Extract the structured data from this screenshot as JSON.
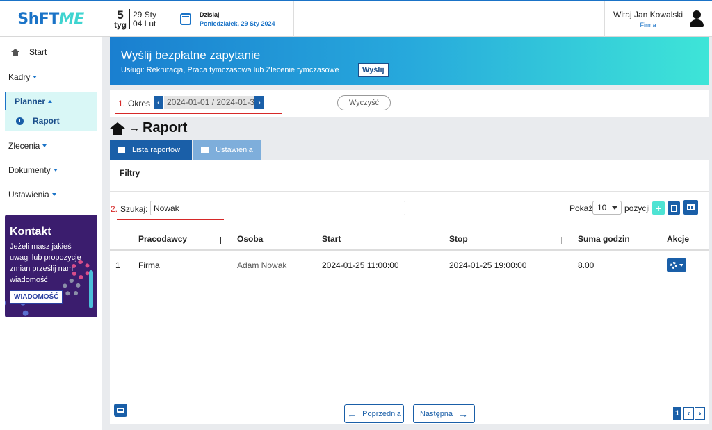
{
  "header": {
    "logo_part1": "ShFT",
    "logo_part2": "ME",
    "week_number": "5",
    "week_label": "tyg",
    "week_start": "29 Sty",
    "week_end": "04 Lut",
    "today_label": "Dzisiaj",
    "today_date": "Poniedziałek, 29 Sty 2024",
    "greeting": "Witaj Jan Kowalski",
    "company": "Firma"
  },
  "sidebar": {
    "items": [
      {
        "label": "Start"
      },
      {
        "label": "Kadry"
      },
      {
        "label": "Planner"
      },
      {
        "label": "Raport"
      },
      {
        "label": "Zlecenia"
      },
      {
        "label": "Dokumenty"
      },
      {
        "label": "Ustawienia"
      }
    ],
    "contact": {
      "title": "Kontakt",
      "text": "Jeżeli masz jakieś uwagi lub propozycje zmian prześlij nam wiadomość",
      "button": "WIADOMOŚĆ"
    }
  },
  "banner": {
    "title": "Wyślij bezpłatne zapytanie",
    "subtitle": "Usługi: Rekrutacja, Praca tymczasowa lub Zlecenie tymczasowe",
    "button": "Wyślij"
  },
  "period": {
    "step": "1.",
    "label": "Okres",
    "value": "2024-01-01 / 2024-01-3",
    "clear": "Wyczyść"
  },
  "page": {
    "title": "Raport",
    "tabs": [
      {
        "label": "Lista raportów"
      },
      {
        "label": "Ustawienia"
      }
    ]
  },
  "filters": {
    "title": "Filtry",
    "search_step": "2.",
    "search_label": "Szukaj:",
    "search_value": "Nowak",
    "show_label": "Pokaż",
    "show_value": "10",
    "per_page_label": "pozycji"
  },
  "table": {
    "columns": [
      "Pracodawcy",
      "Osoba",
      "Start",
      "Stop",
      "Suma godzin",
      "Akcje"
    ],
    "rows": [
      {
        "index": "1",
        "employer": "Firma",
        "person": "Adam Nowak",
        "start": "2024-01-25 11:00:00",
        "stop": "2024-01-25 19:00:00",
        "hours": "8.00"
      }
    ]
  },
  "pagination": {
    "prev": "Poprzednia",
    "next": "Następna",
    "current_page": "1"
  }
}
